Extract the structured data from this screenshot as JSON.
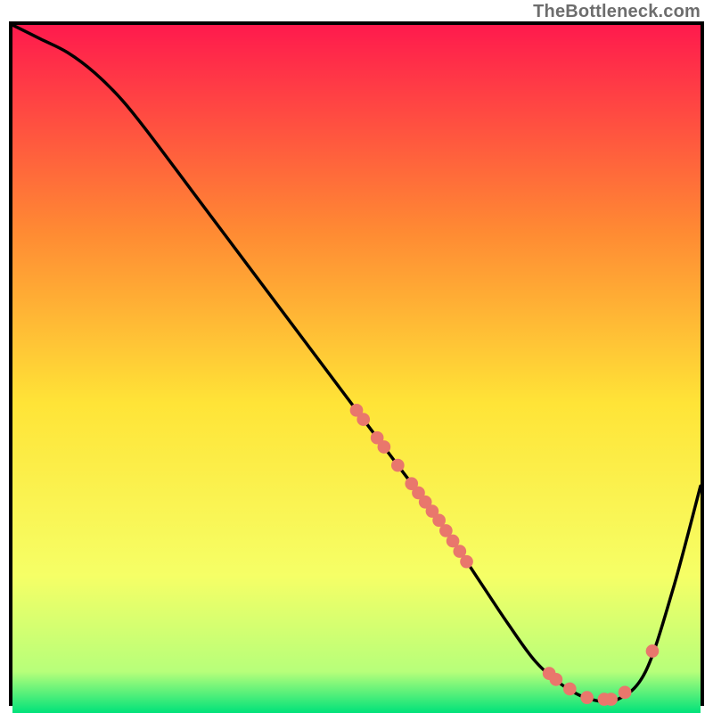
{
  "watermark": "TheBottleneck.com",
  "colors": {
    "curve": "#000000",
    "dot": "#e9776c",
    "frame": "#000000",
    "gradient_top": "#ff1a4d",
    "gradient_mid_upper": "#ff8a33",
    "gradient_mid": "#ffe437",
    "gradient_mid_lower": "#f6ff66",
    "gradient_lower": "#b7ff7a",
    "gradient_bottom": "#00e27a"
  },
  "chart_data": {
    "type": "line",
    "title": "",
    "xlabel": "",
    "ylabel": "",
    "xlim": [
      0,
      100
    ],
    "ylim": [
      0,
      100
    ],
    "series": [
      {
        "name": "curve",
        "x": [
          0,
          4,
          8,
          12,
          16,
          20,
          26,
          32,
          38,
          44,
          50,
          56,
          62,
          68,
          72,
          76,
          80,
          84,
          88,
          92,
          96,
          100
        ],
        "y": [
          100,
          98,
          96,
          93,
          89,
          84,
          76,
          68,
          60,
          52,
          44,
          36,
          28,
          19,
          13,
          7.5,
          4,
          2,
          2,
          6,
          18,
          33
        ]
      }
    ],
    "points_on_curve_x": [
      50,
      51,
      53,
      54,
      56,
      58,
      59,
      60,
      61,
      62,
      63,
      64,
      65,
      66,
      78,
      79,
      81,
      83.5,
      86,
      87,
      89,
      93
    ]
  }
}
